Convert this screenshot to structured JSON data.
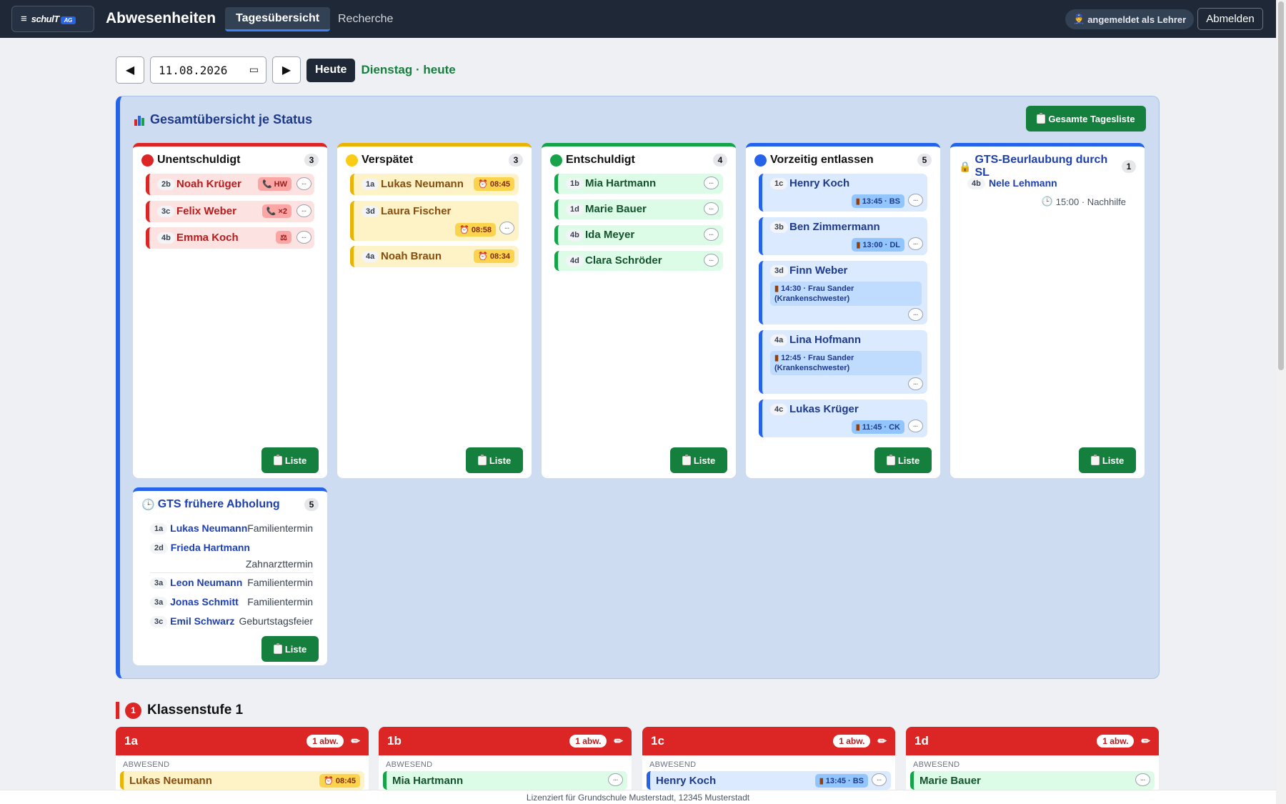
{
  "app": {
    "logo_text": "schulT",
    "logo_badge": "AG",
    "title": "Abwesenheiten",
    "tabs": [
      {
        "label": "Tagesübersicht",
        "active": true
      },
      {
        "label": "Recherche",
        "active": false
      }
    ],
    "login_status": "angemeldet als Lehrer",
    "logout": "Abmelden"
  },
  "date": {
    "value": "11.08.2026",
    "today_button": "Heute",
    "day_label": "Dienstag · heute"
  },
  "overview": {
    "title": "Gesamtübersicht je Status",
    "all_list_button": "Gesamte Tagesliste",
    "list_button": "Liste",
    "columns": {
      "unentschuldigt": {
        "title": "Unentschuldigt",
        "count": "3",
        "color": "#dc2626",
        "items": [
          {
            "cls": "2b",
            "name": "Noah Krüger",
            "tag": "HW"
          },
          {
            "cls": "3c",
            "name": "Felix Weber",
            "tag": "×2"
          },
          {
            "cls": "4b",
            "name": "Emma Koch",
            "tag": ""
          }
        ]
      },
      "verspaetet": {
        "title": "Verspätet",
        "count": "3",
        "color": "#eab308",
        "items": [
          {
            "cls": "1a",
            "name": "Lukas Neumann",
            "time": "08:45"
          },
          {
            "cls": "3d",
            "name": "Laura Fischer",
            "time": "08:58"
          },
          {
            "cls": "4a",
            "name": "Noah Braun",
            "time": "08:34"
          }
        ]
      },
      "entschuldigt": {
        "title": "Entschuldigt",
        "count": "4",
        "color": "#16a34a",
        "items": [
          {
            "cls": "1b",
            "name": "Mia Hartmann"
          },
          {
            "cls": "1d",
            "name": "Marie Bauer"
          },
          {
            "cls": "4b",
            "name": "Ida Meyer"
          },
          {
            "cls": "4d",
            "name": "Clara Schröder"
          }
        ]
      },
      "vorzeitig": {
        "title": "Vorzeitig entlassen",
        "count": "5",
        "color": "#2563eb",
        "items": [
          {
            "cls": "1c",
            "name": "Henry Koch",
            "info": "13:45 · BS"
          },
          {
            "cls": "3b",
            "name": "Ben Zimmermann",
            "info": "13:00 · DL"
          },
          {
            "cls": "3d",
            "name": "Finn Weber",
            "info": "14:30 · Frau Sander (Krankenschwester)"
          },
          {
            "cls": "4a",
            "name": "Lina Hofmann",
            "info": "12:45 · Frau Sander (Krankenschwester)"
          },
          {
            "cls": "4c",
            "name": "Lukas Krüger",
            "info": "11:45 · CK"
          }
        ]
      },
      "gts_beurlaubung": {
        "title": "GTS-Beurlaubung durch SL",
        "count": "1",
        "color": "#2563eb",
        "items": [
          {
            "cls": "4b",
            "name": "Nele Lehmann",
            "info": "15:00 · Nachhilfe"
          }
        ]
      },
      "gts_abholung": {
        "title": "GTS frühere Abholung",
        "count": "5",
        "color": "#2563eb",
        "items": [
          {
            "cls": "1a",
            "name": "Lukas Neumann",
            "reason": "Familientermin"
          },
          {
            "cls": "2d",
            "name": "Frieda Hartmann",
            "reason": "Zahnarzttermin"
          },
          {
            "cls": "3a",
            "name": "Leon Neumann",
            "reason": "Familientermin"
          },
          {
            "cls": "3a",
            "name": "Jonas Schmitt",
            "reason": "Familientermin"
          },
          {
            "cls": "3c",
            "name": "Emil Schwarz",
            "reason": "Geburtstagsfeier"
          }
        ]
      }
    }
  },
  "klassenstufe": {
    "number": "1",
    "title": "Klassenstufe 1",
    "absent_label": "ABWESEND",
    "classes": [
      {
        "name": "1a",
        "badge": "1 abw.",
        "student": "Lukas Neumann",
        "info": "08:45"
      },
      {
        "name": "1b",
        "badge": "1 abw.",
        "student": "Mia Hartmann",
        "info": ""
      },
      {
        "name": "1c",
        "badge": "1 abw.",
        "student": "Henry Koch",
        "info": "13:45 · BS"
      },
      {
        "name": "1d",
        "badge": "1 abw.",
        "student": "Marie Bauer",
        "info": ""
      }
    ]
  },
  "footer": "Lizenziert für Grundschule Musterstadt, 12345 Musterstadt",
  "icons": {
    "menu": "hamburger-icon",
    "clock": "alarm-clock-icon",
    "door": "door-icon",
    "phone": "phone-icon",
    "chat": "speech-bubble-icon",
    "lock": "lock-icon",
    "chart": "bar-chart-icon",
    "clipboard": "clipboard-icon",
    "pencil": "pencil-icon",
    "calendar": "calendar-icon"
  }
}
